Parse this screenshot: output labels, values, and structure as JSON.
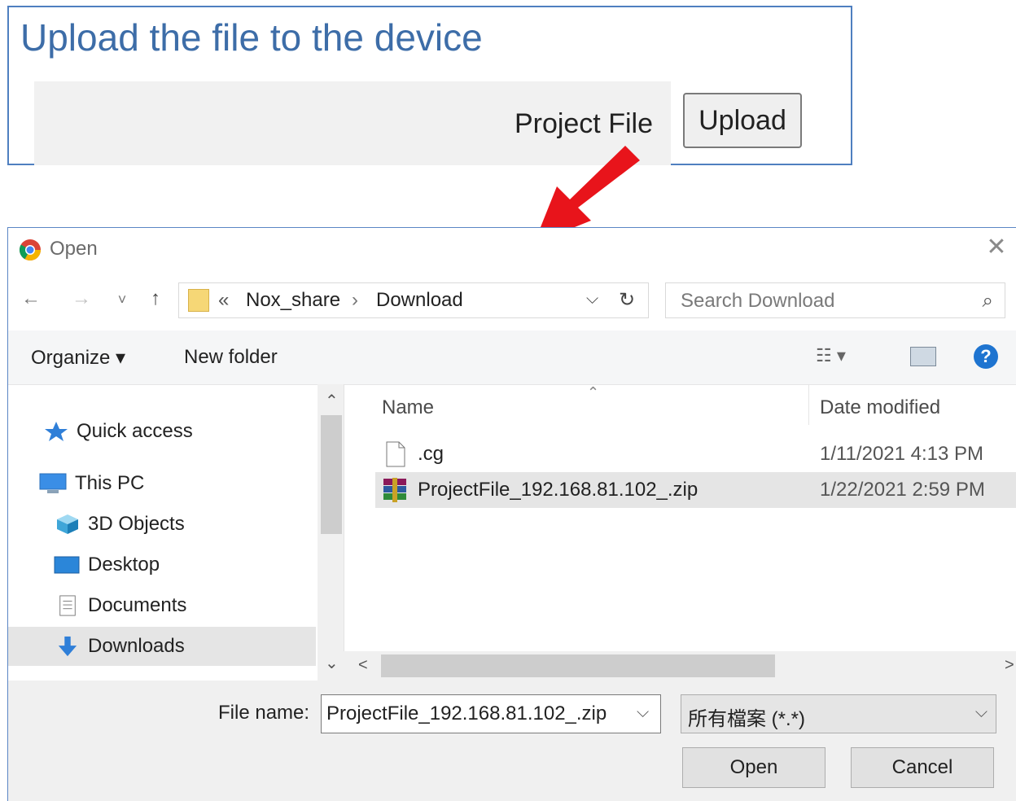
{
  "upload_panel": {
    "title": "Upload the file to the device",
    "field_label": "Project File",
    "upload_label": "Upload"
  },
  "dialog": {
    "title": "Open",
    "close_glyph": "✕",
    "nav": {
      "back": "←",
      "forward": "→",
      "recent": "˅",
      "up": "↑"
    },
    "address": {
      "chevron": "«",
      "crumbs": [
        "Nox_share",
        "Download"
      ],
      "separator": "›",
      "dropdown_glyph": "⌵",
      "refresh_glyph": "↻"
    },
    "search": {
      "placeholder": "Search Download",
      "icon_glyph": "⌕"
    },
    "toolbar": {
      "organize": "Organize ▾",
      "new_folder": "New folder",
      "view_glyph": "☷ ▾",
      "help_glyph": "?"
    },
    "nav_pane": {
      "items": [
        {
          "label": "Quick access",
          "icon": "star-icon"
        },
        {
          "label": "This PC",
          "icon": "computer-icon"
        },
        {
          "label": "3D Objects",
          "icon": "cube-icon"
        },
        {
          "label": "Desktop",
          "icon": "desktop-icon"
        },
        {
          "label": "Documents",
          "icon": "documents-icon"
        },
        {
          "label": "Downloads",
          "icon": "download-arrow-icon"
        }
      ],
      "selected": "Downloads",
      "scroll_up": "⌃",
      "scroll_down": "⌄"
    },
    "file_list": {
      "sort_caret": "⌃",
      "columns": {
        "name": "Name",
        "date": "Date modified"
      },
      "rows": [
        {
          "name": ".cg",
          "date": "1/11/2021 4:13 PM",
          "icon": "blank-file-icon"
        },
        {
          "name": "ProjectFile_192.168.81.102_.zip",
          "date": "1/22/2021 2:59 PM",
          "icon": "winrar-archive-icon",
          "selected": true
        }
      ],
      "scroll_left": "<",
      "scroll_right": ">"
    },
    "bottom": {
      "file_name_label": "File name:",
      "file_name_value": "ProjectFile_192.168.81.102_.zip",
      "file_name_dd": "⌵",
      "file_type": "所有檔案 (*.*)",
      "file_type_dd": "⌵",
      "open_label": "Open",
      "cancel_label": "Cancel"
    }
  },
  "colors": {
    "panel_border": "#4f7fc0",
    "title_blue": "#3d6da8",
    "arrow_red": "#e8141b",
    "selection_gray": "#e5e5e5",
    "help_blue": "#1e74d0"
  }
}
